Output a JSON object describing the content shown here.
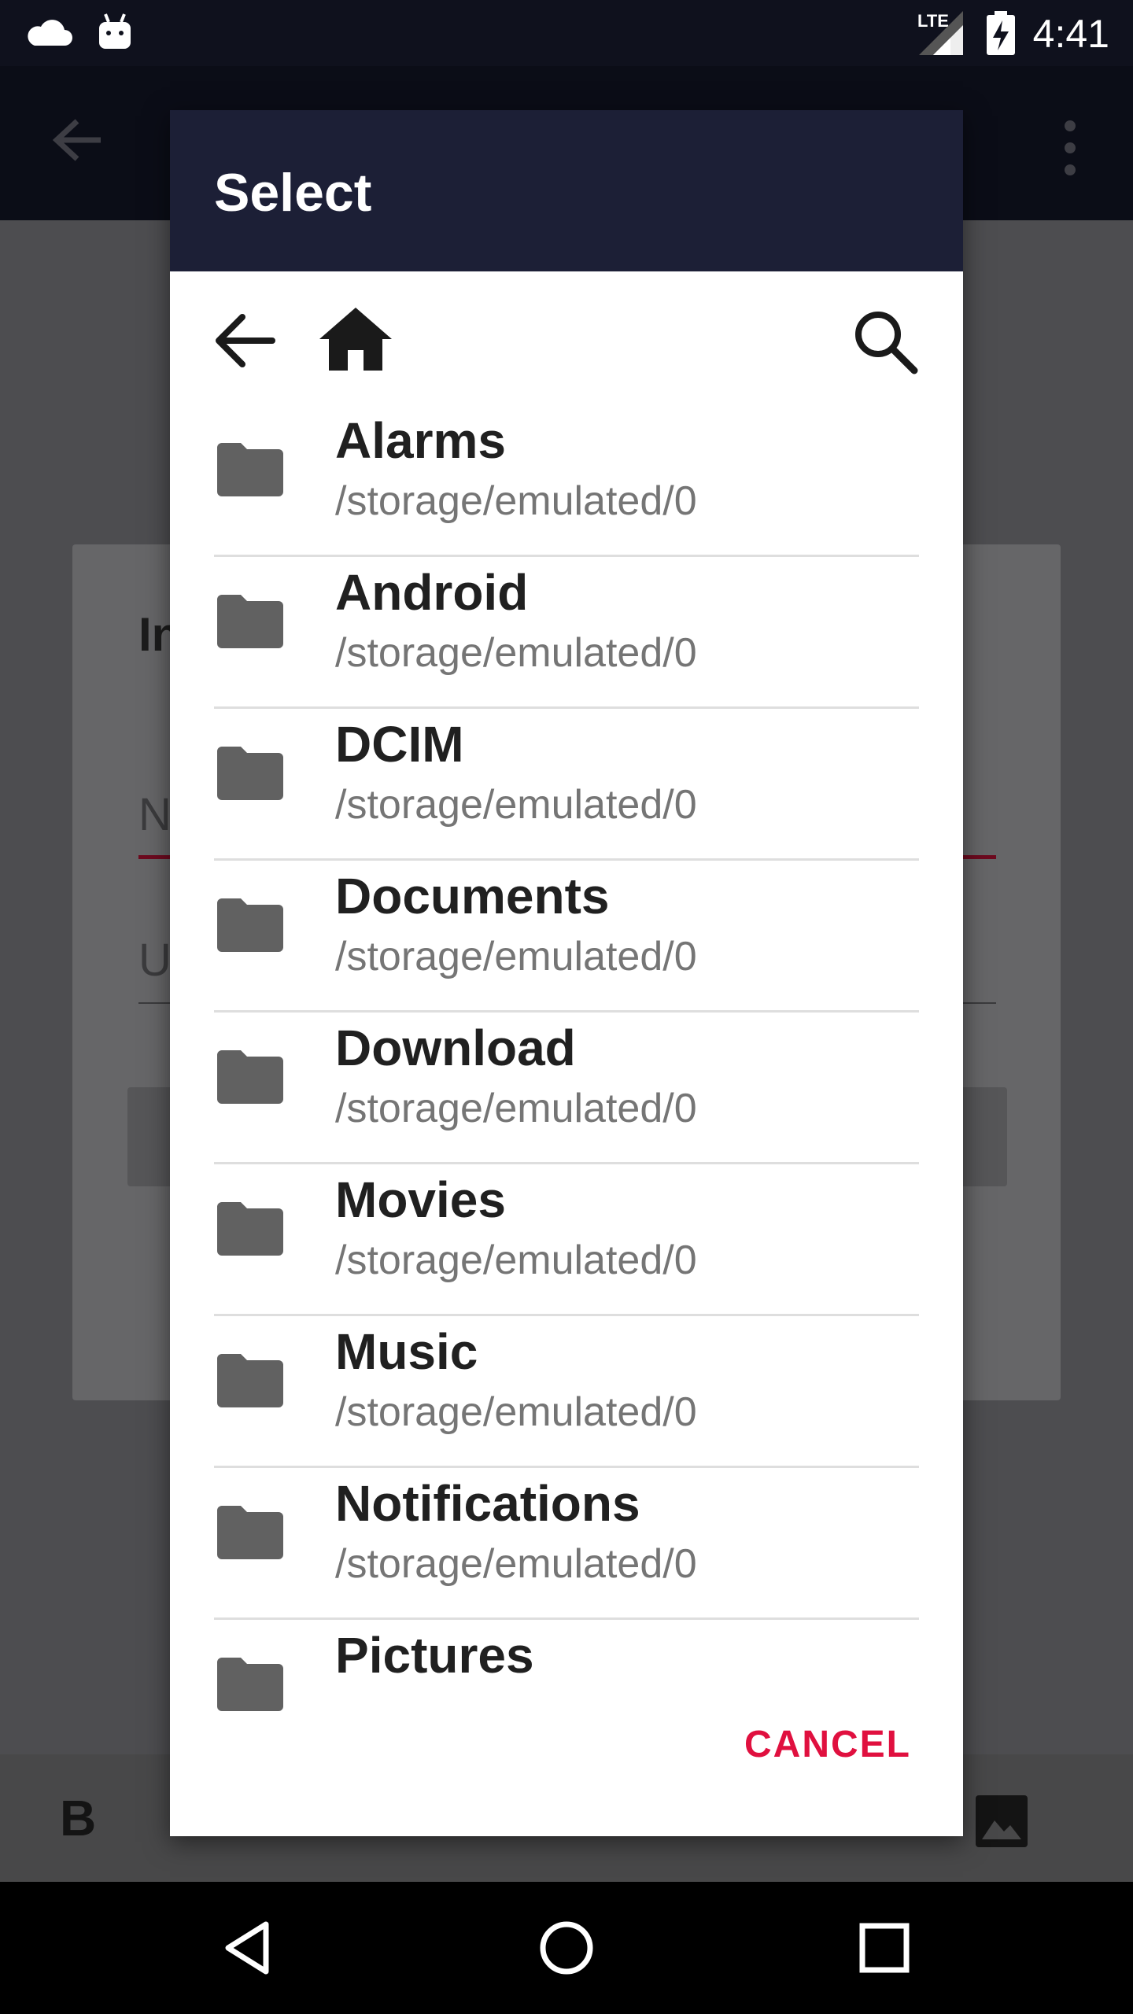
{
  "status_bar": {
    "time": "4:41",
    "network": "LTE",
    "icons": [
      "cloud-icon",
      "android-icon",
      "lte-signal-icon",
      "battery-charging-icon"
    ]
  },
  "background": {
    "card_title": "In",
    "field1_hint": "N",
    "field2_hint": "U",
    "format_bold": "B"
  },
  "dialog": {
    "title": "Select",
    "toolbar": {
      "back": "arrow-left-icon",
      "home": "home-icon",
      "search": "search-icon"
    },
    "items": [
      {
        "name": "Alarms",
        "path": "/storage/emulated/0"
      },
      {
        "name": "Android",
        "path": "/storage/emulated/0"
      },
      {
        "name": "DCIM",
        "path": "/storage/emulated/0"
      },
      {
        "name": "Documents",
        "path": "/storage/emulated/0"
      },
      {
        "name": "Download",
        "path": "/storage/emulated/0"
      },
      {
        "name": "Movies",
        "path": "/storage/emulated/0"
      },
      {
        "name": "Music",
        "path": "/storage/emulated/0"
      },
      {
        "name": "Notifications",
        "path": "/storage/emulated/0"
      },
      {
        "name": "Pictures",
        "path": ""
      }
    ],
    "cancel_label": "CANCEL",
    "accent_color": "#e0103f",
    "header_color": "#1c1f36"
  },
  "nav_bar": {
    "buttons": [
      "back-triangle-icon",
      "home-circle-icon",
      "recents-square-icon"
    ]
  }
}
